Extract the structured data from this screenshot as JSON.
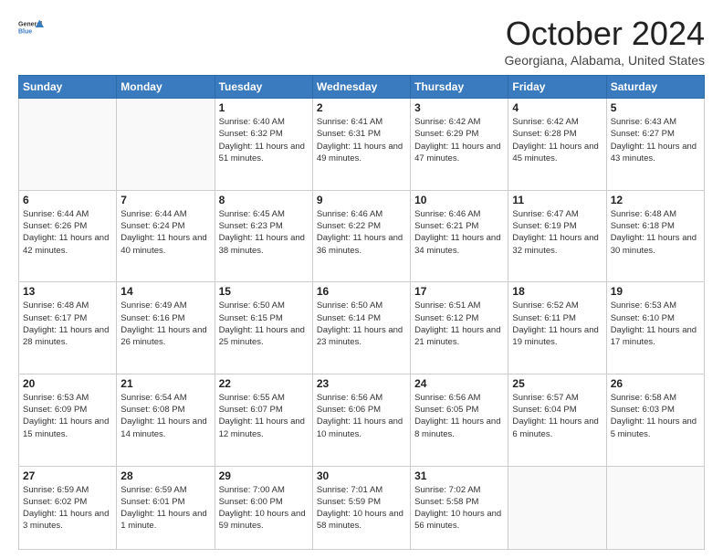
{
  "logo": {
    "line1": "General",
    "line2": "Blue"
  },
  "title": "October 2024",
  "subtitle": "Georgiana, Alabama, United States",
  "days_of_week": [
    "Sunday",
    "Monday",
    "Tuesday",
    "Wednesday",
    "Thursday",
    "Friday",
    "Saturday"
  ],
  "weeks": [
    [
      {
        "day": "",
        "info": ""
      },
      {
        "day": "",
        "info": ""
      },
      {
        "day": "1",
        "info": "Sunrise: 6:40 AM\nSunset: 6:32 PM\nDaylight: 11 hours and 51 minutes."
      },
      {
        "day": "2",
        "info": "Sunrise: 6:41 AM\nSunset: 6:31 PM\nDaylight: 11 hours and 49 minutes."
      },
      {
        "day": "3",
        "info": "Sunrise: 6:42 AM\nSunset: 6:29 PM\nDaylight: 11 hours and 47 minutes."
      },
      {
        "day": "4",
        "info": "Sunrise: 6:42 AM\nSunset: 6:28 PM\nDaylight: 11 hours and 45 minutes."
      },
      {
        "day": "5",
        "info": "Sunrise: 6:43 AM\nSunset: 6:27 PM\nDaylight: 11 hours and 43 minutes."
      }
    ],
    [
      {
        "day": "6",
        "info": "Sunrise: 6:44 AM\nSunset: 6:26 PM\nDaylight: 11 hours and 42 minutes."
      },
      {
        "day": "7",
        "info": "Sunrise: 6:44 AM\nSunset: 6:24 PM\nDaylight: 11 hours and 40 minutes."
      },
      {
        "day": "8",
        "info": "Sunrise: 6:45 AM\nSunset: 6:23 PM\nDaylight: 11 hours and 38 minutes."
      },
      {
        "day": "9",
        "info": "Sunrise: 6:46 AM\nSunset: 6:22 PM\nDaylight: 11 hours and 36 minutes."
      },
      {
        "day": "10",
        "info": "Sunrise: 6:46 AM\nSunset: 6:21 PM\nDaylight: 11 hours and 34 minutes."
      },
      {
        "day": "11",
        "info": "Sunrise: 6:47 AM\nSunset: 6:19 PM\nDaylight: 11 hours and 32 minutes."
      },
      {
        "day": "12",
        "info": "Sunrise: 6:48 AM\nSunset: 6:18 PM\nDaylight: 11 hours and 30 minutes."
      }
    ],
    [
      {
        "day": "13",
        "info": "Sunrise: 6:48 AM\nSunset: 6:17 PM\nDaylight: 11 hours and 28 minutes."
      },
      {
        "day": "14",
        "info": "Sunrise: 6:49 AM\nSunset: 6:16 PM\nDaylight: 11 hours and 26 minutes."
      },
      {
        "day": "15",
        "info": "Sunrise: 6:50 AM\nSunset: 6:15 PM\nDaylight: 11 hours and 25 minutes."
      },
      {
        "day": "16",
        "info": "Sunrise: 6:50 AM\nSunset: 6:14 PM\nDaylight: 11 hours and 23 minutes."
      },
      {
        "day": "17",
        "info": "Sunrise: 6:51 AM\nSunset: 6:12 PM\nDaylight: 11 hours and 21 minutes."
      },
      {
        "day": "18",
        "info": "Sunrise: 6:52 AM\nSunset: 6:11 PM\nDaylight: 11 hours and 19 minutes."
      },
      {
        "day": "19",
        "info": "Sunrise: 6:53 AM\nSunset: 6:10 PM\nDaylight: 11 hours and 17 minutes."
      }
    ],
    [
      {
        "day": "20",
        "info": "Sunrise: 6:53 AM\nSunset: 6:09 PM\nDaylight: 11 hours and 15 minutes."
      },
      {
        "day": "21",
        "info": "Sunrise: 6:54 AM\nSunset: 6:08 PM\nDaylight: 11 hours and 14 minutes."
      },
      {
        "day": "22",
        "info": "Sunrise: 6:55 AM\nSunset: 6:07 PM\nDaylight: 11 hours and 12 minutes."
      },
      {
        "day": "23",
        "info": "Sunrise: 6:56 AM\nSunset: 6:06 PM\nDaylight: 11 hours and 10 minutes."
      },
      {
        "day": "24",
        "info": "Sunrise: 6:56 AM\nSunset: 6:05 PM\nDaylight: 11 hours and 8 minutes."
      },
      {
        "day": "25",
        "info": "Sunrise: 6:57 AM\nSunset: 6:04 PM\nDaylight: 11 hours and 6 minutes."
      },
      {
        "day": "26",
        "info": "Sunrise: 6:58 AM\nSunset: 6:03 PM\nDaylight: 11 hours and 5 minutes."
      }
    ],
    [
      {
        "day": "27",
        "info": "Sunrise: 6:59 AM\nSunset: 6:02 PM\nDaylight: 11 hours and 3 minutes."
      },
      {
        "day": "28",
        "info": "Sunrise: 6:59 AM\nSunset: 6:01 PM\nDaylight: 11 hours and 1 minute."
      },
      {
        "day": "29",
        "info": "Sunrise: 7:00 AM\nSunset: 6:00 PM\nDaylight: 10 hours and 59 minutes."
      },
      {
        "day": "30",
        "info": "Sunrise: 7:01 AM\nSunset: 5:59 PM\nDaylight: 10 hours and 58 minutes."
      },
      {
        "day": "31",
        "info": "Sunrise: 7:02 AM\nSunset: 5:58 PM\nDaylight: 10 hours and 56 minutes."
      },
      {
        "day": "",
        "info": ""
      },
      {
        "day": "",
        "info": ""
      }
    ]
  ]
}
